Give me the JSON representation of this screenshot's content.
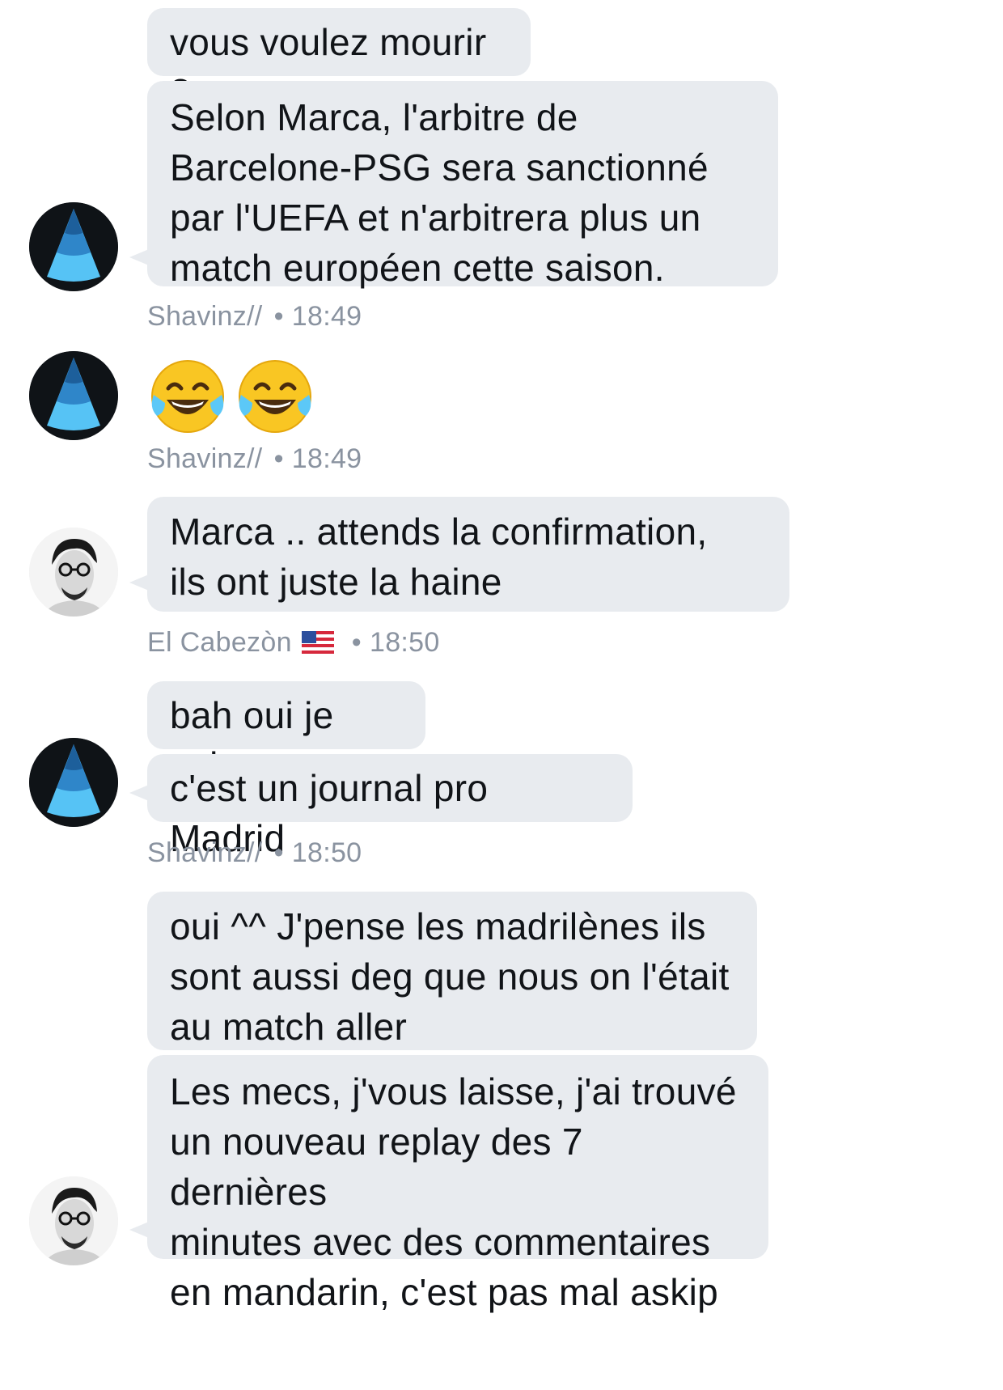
{
  "messages": [
    {
      "text": "vous voulez mourir ?"
    },
    {
      "text": "Selon Marca, l'arbitre de\nBarcelone-PSG sera sanctionné\npar l'UEFA et n'arbitrera plus un\nmatch européen cette saison."
    },
    {
      "meta_user": "Shavinz//",
      "meta_time": "18:49"
    },
    {
      "emoji": "face-with-tears-of-joy",
      "count": 2
    },
    {
      "meta_user": "Shavinz//",
      "meta_time": "18:49"
    },
    {
      "text": "Marca .. attends la confirmation,\nils ont juste la haine"
    },
    {
      "meta_user": "El Cabezòn",
      "meta_time": "18:50",
      "flag": "us-flag"
    },
    {
      "text": "bah oui je sais"
    },
    {
      "text": "c'est un journal pro Madrid"
    },
    {
      "meta_user": "Shavinz//",
      "meta_time": "18:50"
    },
    {
      "text": "oui ^^ J'pense les madrilènes ils\nsont aussi deg que nous on l'était\nau match aller"
    },
    {
      "text": "Les mecs, j'vous laisse, j'ai trouvé\nun nouveau replay des 7 dernières\nminutes avec des commentaires\nen mandarin, c'est pas mal askip"
    }
  ],
  "meta_separator": "•",
  "colors": {
    "bubble": "#e8ebef",
    "meta_text": "#8a93a0",
    "avatar_cone": "#3fa6e6"
  }
}
